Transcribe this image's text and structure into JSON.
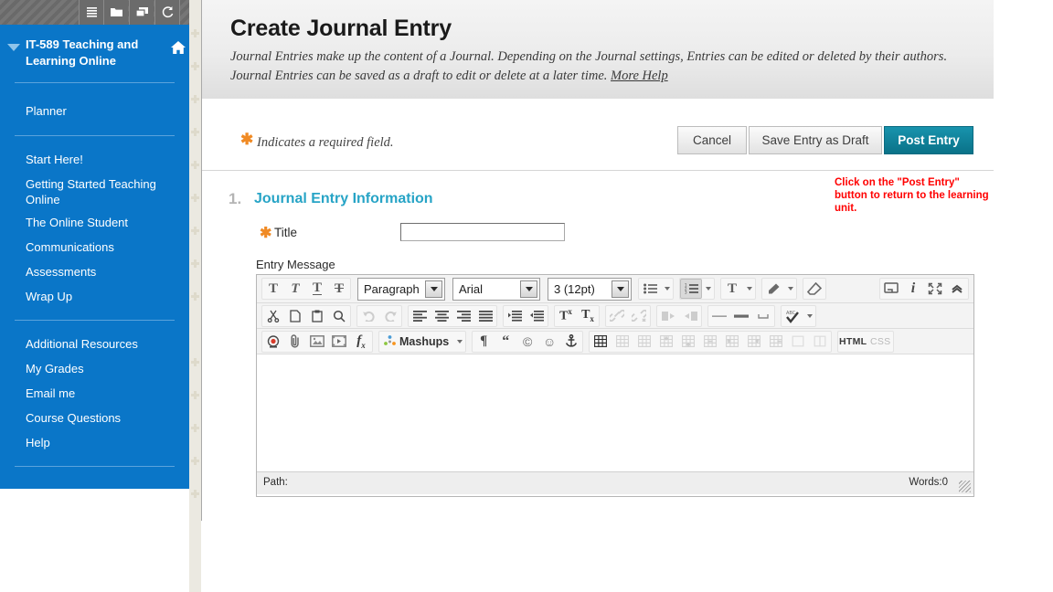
{
  "topbar": {
    "icons": [
      "menu-icon",
      "folder-icon",
      "window-icon",
      "refresh-icon"
    ]
  },
  "sidebar": {
    "course_title": "IT-589 Teaching and Learning Online",
    "home_icon": "home-icon",
    "collapse_icon": "caret-down-icon",
    "groups": [
      {
        "items": [
          {
            "label": "Planner"
          }
        ]
      },
      {
        "items": [
          {
            "label": "Start Here!"
          },
          {
            "label": "Getting Started Teaching Online"
          },
          {
            "label": "The Online Student"
          },
          {
            "label": "Communications"
          },
          {
            "label": "Assessments"
          },
          {
            "label": "Wrap Up"
          }
        ]
      },
      {
        "items": [
          {
            "label": "Additional Resources"
          },
          {
            "label": "My Grades"
          },
          {
            "label": "Email me"
          },
          {
            "label": "Course Questions"
          },
          {
            "label": "Help"
          }
        ]
      }
    ]
  },
  "header": {
    "title": "Create Journal Entry",
    "description": "Journal Entries make up the content of a Journal. Depending on the Journal settings, Entries can be edited or deleted by their authors. Journal Entries can be saved as a draft to edit or delete at a later time.",
    "more_help": "More Help"
  },
  "actionbar": {
    "required_note": "Indicates a required field.",
    "cancel_label": "Cancel",
    "save_draft_label": "Save Entry as Draft",
    "post_label": "Post Entry"
  },
  "section": {
    "number": "1.",
    "title": "Journal Entry Information",
    "annotation": "Click on the \"Post Entry\" button to  return to the learning unit."
  },
  "form": {
    "title_label": "Title",
    "title_value": "",
    "title_placeholder": "",
    "entry_message_label": "Entry Message"
  },
  "editor": {
    "row1": {
      "text_styles": [
        "bold-T-icon",
        "italic-T-icon",
        "underline-T-icon",
        "strikethrough-T-icon"
      ],
      "paragraph_value": "Paragraph",
      "font_value": "Arial",
      "size_value": "3 (12pt)",
      "list_icons": [
        "bullet-list-icon",
        "numbered-list-icon"
      ],
      "text_color_icon": "text-color-icon",
      "highlight_icon": "highlighter-icon",
      "eraser_icon": "eraser-icon",
      "right_icons": [
        "preview-icon",
        "info-icon",
        "fullscreen-icon",
        "collapse-toolbar-icon"
      ]
    },
    "row2": {
      "clipboard_icons": [
        "cut-icon",
        "copy-icon",
        "paste-icon",
        "find-icon"
      ],
      "history_icons": [
        "undo-icon",
        "redo-icon"
      ],
      "align_icons": [
        "align-left-icon",
        "align-center-icon",
        "align-right-icon",
        "align-justify-icon"
      ],
      "indent_icons": [
        "indent-icon",
        "outdent-icon"
      ],
      "script_icons": [
        "superscript-icon",
        "subscript-icon"
      ],
      "link_icons": [
        "link-icon",
        "unlink-icon"
      ],
      "direction_icons": [
        "ltr-icon",
        "rtl-icon"
      ],
      "rule_icons": [
        "thin-rule-icon",
        "thick-rule-icon",
        "nbsp-icon"
      ],
      "spellcheck_icon": "spellcheck-icon"
    },
    "row3": {
      "media_icons": [
        "record-icon",
        "attach-icon",
        "image-icon",
        "video-icon",
        "math-icon"
      ],
      "mashups_label": "Mashups",
      "insert_icons": [
        "paragraph-mark-icon",
        "quote-icon",
        "copyright-icon",
        "emoji-icon",
        "anchor-icon"
      ],
      "table_icons": [
        "insert-table-icon",
        "table-props-icon",
        "delete-table-icon",
        "insert-row-before-icon",
        "insert-row-after-icon",
        "delete-row-icon",
        "insert-col-before-icon",
        "insert-col-after-icon",
        "delete-col-icon",
        "merge-cells-icon",
        "split-cell-icon"
      ],
      "html_label": "HTML",
      "css_label": "CSS"
    },
    "statusbar": {
      "path_label": "Path:",
      "words_label": "Words:0",
      "resize_handle": "resize-grip-icon"
    }
  },
  "colors": {
    "sidebar_blue": "#0a76c8",
    "post_entry_teal": "#0a7288",
    "section_title": "#27a4c6",
    "required_orange": "#f08a24",
    "annotation_red": "#ff0000"
  }
}
